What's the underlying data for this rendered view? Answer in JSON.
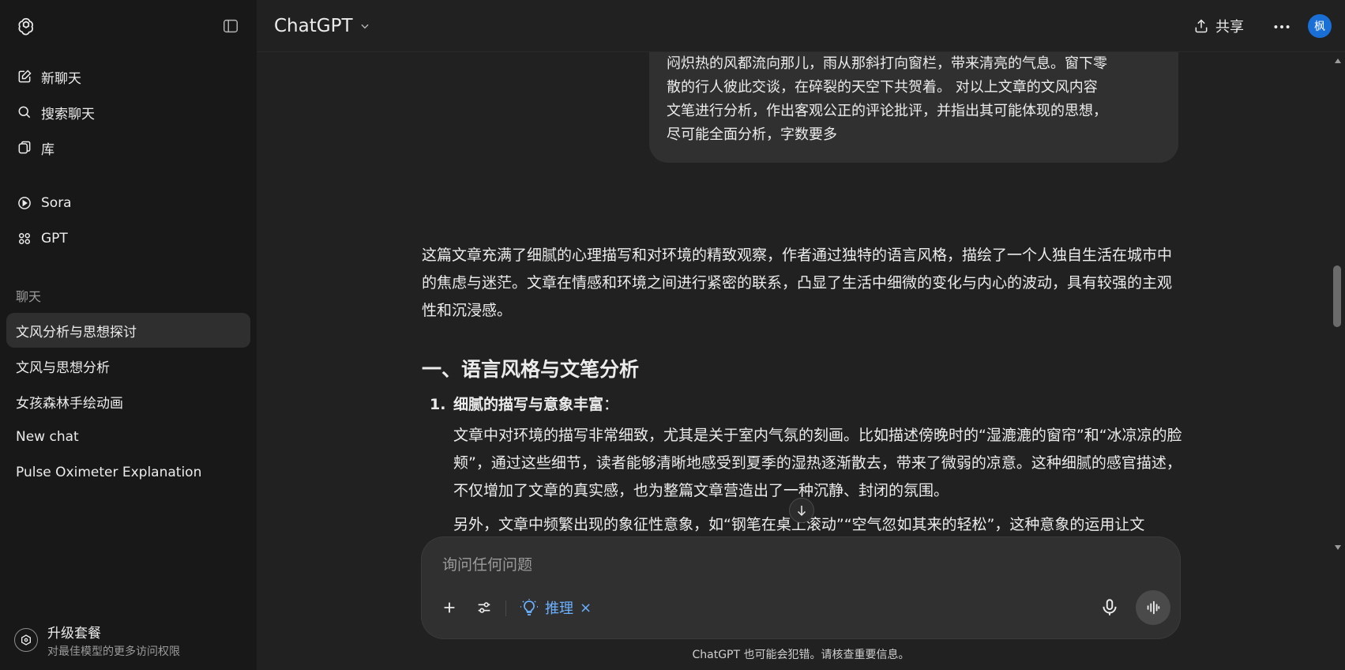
{
  "sidebar": {
    "top_items": [
      {
        "label": "新聊天",
        "icon": "new-chat-icon"
      },
      {
        "label": "搜索聊天",
        "icon": "search-icon"
      },
      {
        "label": "库",
        "icon": "library-icon"
      }
    ],
    "tool_items": [
      {
        "label": "Sora",
        "icon": "play-icon"
      },
      {
        "label": "GPT",
        "icon": "gpts-icon"
      }
    ],
    "section_label": "聊天",
    "chats": [
      {
        "label": "文风分析与思想探讨",
        "active": true
      },
      {
        "label": "文风与思想分析",
        "active": false
      },
      {
        "label": "女孩森林手绘动画",
        "active": false
      },
      {
        "label": "New chat",
        "active": false
      },
      {
        "label": "Pulse Oximeter Explanation",
        "active": false
      }
    ],
    "upgrade": {
      "title": "升级套餐",
      "subtitle": "对最佳模型的更多访问权限"
    }
  },
  "header": {
    "model": "ChatGPT",
    "share_label": "共享",
    "avatar_text": "枫"
  },
  "conversation": {
    "user_message_lines": [
      "闷炽热的风都流向那儿，雨从那斜打向窗栏，带来清亮的气息。窗下零",
      "散的行人彼此交谈，在碎裂的天空下共贺着。 对以上文章的文风内容",
      "文笔进行分析，作出客观公正的评论批评，并指出其可能体现的思想，",
      "尽可能全面分析，字数要多"
    ],
    "intro": "这篇文章充满了细腻的心理描写和对环境的精致观察，作者通过独特的语言风格，描绘了一个人独自生活在城市中的焦虑与迷茫。文章在情感和环境之间进行紧密的联系，凸显了生活中细微的变化与内心的波动，具有较强的主观性和沉浸感。",
    "section_heading": "一、语言风格与文笔分析",
    "list_item": {
      "number": "1.",
      "title": "细腻的描写与意象丰富",
      "colon": "：",
      "paragraph1": "文章中对环境的描写非常细致，尤其是关于室内气氛的刻画。比如描述傍晚时的“湿漉漉的窗帘”和“冰凉凉的脸颊”，通过这些细节，读者能够清晰地感受到夏季的湿热逐渐散去，带来了微弱的凉意。这种细腻的感官描述，不仅增加了文章的真实感，也为整篇文章营造出了一种沉静、封闭的氛围。",
      "paragraph2": "另外，文章中频繁出现的象征性意象，如“钢笔在桌上滚动”“空气忽如其来的轻松”，这种意象的运用让文"
    }
  },
  "composer": {
    "placeholder": "询问任何问题",
    "reasoning_label": "推理",
    "reasoning_close": "×"
  },
  "disclaimer": "ChatGPT 也可能会犯错。请核查重要信息。",
  "colors": {
    "background": "#212121",
    "sidebar": "#181818",
    "bubble": "#303030",
    "accent": "#6ab0ff",
    "avatar": "#1a6fd6"
  }
}
